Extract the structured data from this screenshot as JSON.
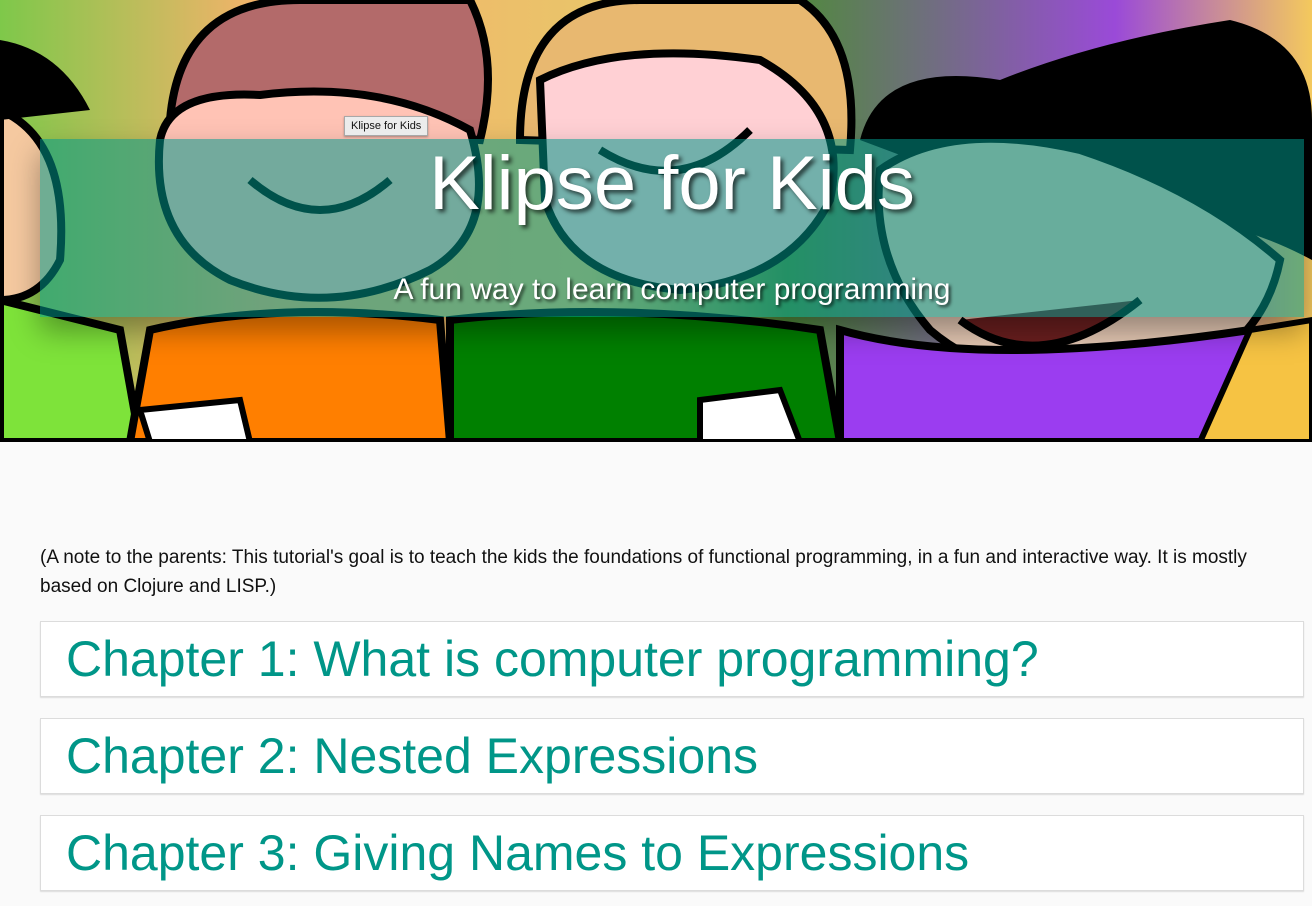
{
  "hero": {
    "background_image": "cartoon-kids-illustration",
    "title": "Klipse for Kids",
    "subtitle": "A fun way to learn computer programming",
    "banner_color": "#009688"
  },
  "tooltip": {
    "text": "Klipse for Kids"
  },
  "note": {
    "text": "(A note to the parents: This tutorial's goal is to teach the kids the foundations of functional programming, in a fun and interactive way. It is mostly based on Clojure and LISP.)"
  },
  "chapters": [
    {
      "title": "Chapter 1: What is computer programming?"
    },
    {
      "title": "Chapter 2: Nested Expressions"
    },
    {
      "title": "Chapter 3: Giving Names to Expressions"
    }
  ],
  "colors": {
    "accent": "#009688",
    "page_background": "#fafafa"
  }
}
